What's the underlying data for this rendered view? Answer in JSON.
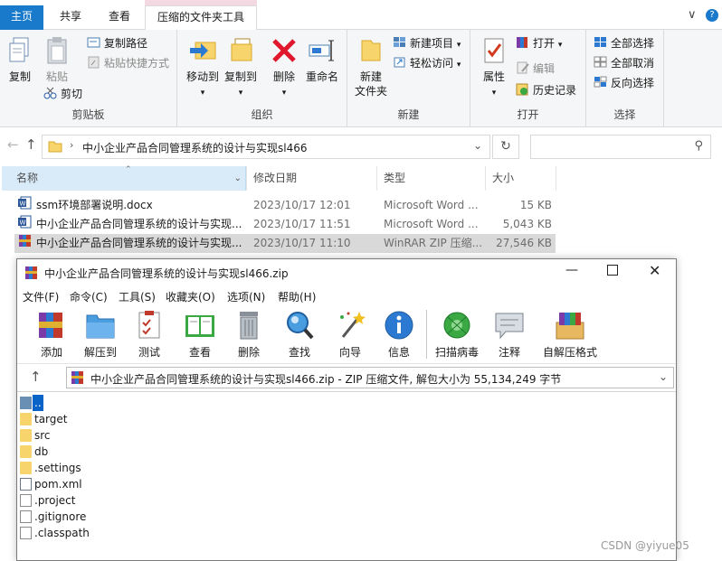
{
  "explorer": {
    "tabs": [
      "主页",
      "共享",
      "查看",
      "压缩的文件夹工具"
    ],
    "window_controls": {
      "chevron": "∨",
      "help": "?"
    },
    "ribbon": {
      "clipboard": {
        "group_label": "剪贴板",
        "copy": "复制",
        "paste": "粘贴",
        "copy_path": "复制路径",
        "paste_shortcut": "粘贴快捷方式",
        "cut": "剪切"
      },
      "organize": {
        "group_label": "组织",
        "move_to": "移动到",
        "copy_to": "复制到",
        "delete": "删除",
        "rename": "重命名"
      },
      "new": {
        "group_label": "新建",
        "new_folder_line1": "新建",
        "new_folder_line2": "文件夹",
        "new_item": "新建项目",
        "easy_access": "轻松访问"
      },
      "open": {
        "group_label": "打开",
        "properties": "属性",
        "open": "打开",
        "edit": "编辑",
        "history": "历史记录"
      },
      "select": {
        "group_label": "选择",
        "select_all": "全部选择",
        "select_none": "全部取消",
        "invert": "反向选择"
      }
    },
    "address": {
      "path": "中小企业产品合同管理系统的设计与实现sl466",
      "search_placeholder": ""
    },
    "columns": {
      "name": "名称",
      "date": "修改日期",
      "type": "类型",
      "size": "大小"
    },
    "files": [
      {
        "name": "ssm环境部署说明.docx",
        "date": "2023/10/17 12:01",
        "type": "Microsoft Word ...",
        "size": "15 KB",
        "icon": "word-icon"
      },
      {
        "name": "中小企业产品合同管理系统的设计与实现...",
        "date": "2023/10/17 11:51",
        "type": "Microsoft Word ...",
        "size": "5,043 KB",
        "icon": "word-icon"
      },
      {
        "name": "中小企业产品合同管理系统的设计与实现...",
        "date": "2023/10/17 11:10",
        "type": "WinRAR ZIP 压缩...",
        "size": "27,546 KB",
        "icon": "winrar-icon"
      }
    ]
  },
  "winrar": {
    "title": "中小企业产品合同管理系统的设计与实现sl466.zip",
    "menu": [
      "文件(F)",
      "命令(C)",
      "工具(S)",
      "收藏夹(O)",
      "选项(N)",
      "帮助(H)"
    ],
    "tools": [
      "添加",
      "解压到",
      "测试",
      "查看",
      "删除",
      "查找",
      "向导",
      "信息",
      "扫描病毒",
      "注释",
      "自解压格式"
    ],
    "path": "中小企业产品合同管理系统的设计与实现sl466.zip - ZIP 压缩文件, 解包大小为 55,134,249 字节",
    "entries": [
      {
        "name": "..",
        "kind": "up"
      },
      {
        "name": "target",
        "kind": "folder"
      },
      {
        "name": "src",
        "kind": "folder"
      },
      {
        "name": "db",
        "kind": "folder"
      },
      {
        "name": ".settings",
        "kind": "folder"
      },
      {
        "name": "pom.xml",
        "kind": "xml"
      },
      {
        "name": ".project",
        "kind": "file"
      },
      {
        "name": ".gitignore",
        "kind": "file"
      },
      {
        "name": ".classpath",
        "kind": "file"
      }
    ]
  },
  "watermark": "CSDN @yiyue05"
}
